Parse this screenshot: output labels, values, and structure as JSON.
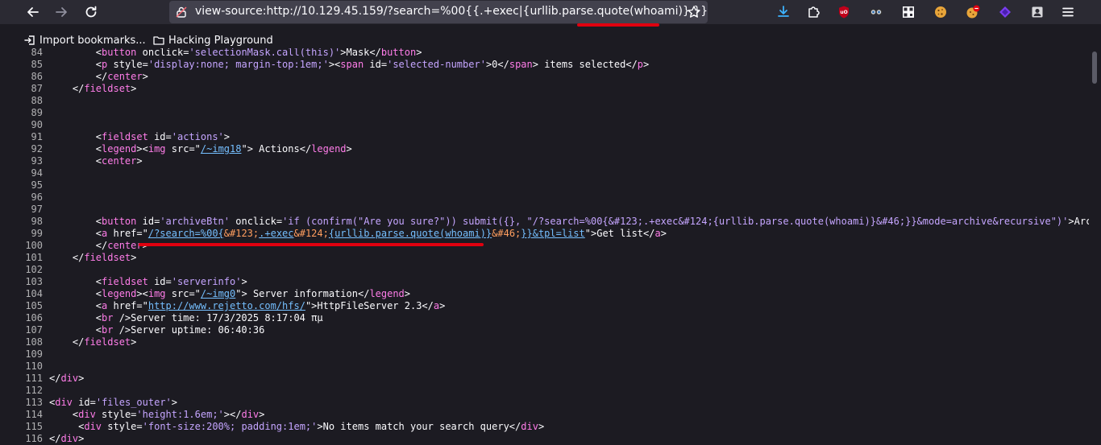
{
  "browser": {
    "url": "view-source:http://10.129.45.159/?search=%00{{.+exec|{urllib.parse.quote(whoami)}.}}",
    "bookmarks": [
      {
        "label": "Import bookmarks...",
        "icon": "import-icon"
      },
      {
        "label": "Hacking Playground",
        "icon": "folder-icon"
      }
    ],
    "colors": {
      "toolbar": "#2b2a33",
      "urlbar": "#42414d",
      "page": "#1c1b22",
      "annotation": "#e0000f"
    }
  },
  "source": {
    "lines": [
      {
        "n": "84",
        "parts": [
          [
            "t",
            "        <"
          ],
          [
            "tag",
            "button"
          ],
          [
            "t",
            " "
          ],
          [
            "an",
            "onclick"
          ],
          [
            "t",
            "="
          ],
          [
            "av",
            "'selectionMask.call(this)'"
          ],
          [
            "t",
            ">Mask</"
          ],
          [
            "tag",
            "button"
          ],
          [
            "t",
            ">"
          ]
        ]
      },
      {
        "n": "85",
        "parts": [
          [
            "t",
            "        <"
          ],
          [
            "tag",
            "p"
          ],
          [
            "t",
            " "
          ],
          [
            "an",
            "style"
          ],
          [
            "t",
            "="
          ],
          [
            "av",
            "'display:none; margin-top:1em;'"
          ],
          [
            "t",
            "><"
          ],
          [
            "tag",
            "span"
          ],
          [
            "t",
            " "
          ],
          [
            "an",
            "id"
          ],
          [
            "t",
            "="
          ],
          [
            "av",
            "'selected-number'"
          ],
          [
            "t",
            ">0</"
          ],
          [
            "tag",
            "span"
          ],
          [
            "t",
            "> items selected</"
          ],
          [
            "tag",
            "p"
          ],
          [
            "t",
            ">"
          ]
        ]
      },
      {
        "n": "86",
        "parts": [
          [
            "t",
            "        </"
          ],
          [
            "tag",
            "center"
          ],
          [
            "t",
            ">"
          ]
        ]
      },
      {
        "n": "87",
        "parts": [
          [
            "t",
            "    </"
          ],
          [
            "tag",
            "fieldset"
          ],
          [
            "t",
            ">"
          ]
        ]
      },
      {
        "n": "88",
        "parts": []
      },
      {
        "n": "89",
        "parts": []
      },
      {
        "n": "90",
        "parts": []
      },
      {
        "n": "91",
        "parts": [
          [
            "t",
            "        <"
          ],
          [
            "tag",
            "fieldset"
          ],
          [
            "t",
            " "
          ],
          [
            "an",
            "id"
          ],
          [
            "t",
            "="
          ],
          [
            "av",
            "'actions'"
          ],
          [
            "t",
            ">"
          ]
        ]
      },
      {
        "n": "92",
        "parts": [
          [
            "t",
            "        <"
          ],
          [
            "tag",
            "legend"
          ],
          [
            "t",
            "><"
          ],
          [
            "tag",
            "img"
          ],
          [
            "t",
            " "
          ],
          [
            "an",
            "src"
          ],
          [
            "t",
            "=\""
          ],
          [
            "lk",
            "/~img18"
          ],
          [
            "t",
            "\"> Actions</"
          ],
          [
            "tag",
            "legend"
          ],
          [
            "t",
            ">"
          ]
        ]
      },
      {
        "n": "93",
        "parts": [
          [
            "t",
            "        <"
          ],
          [
            "tag",
            "center"
          ],
          [
            "t",
            ">"
          ]
        ]
      },
      {
        "n": "94",
        "parts": []
      },
      {
        "n": "95",
        "parts": []
      },
      {
        "n": "96",
        "parts": []
      },
      {
        "n": "97",
        "parts": []
      },
      {
        "n": "98",
        "parts": [
          [
            "t",
            "        <"
          ],
          [
            "tag",
            "button"
          ],
          [
            "t",
            " "
          ],
          [
            "an",
            "id"
          ],
          [
            "t",
            "="
          ],
          [
            "av",
            "'archiveBtn'"
          ],
          [
            "t",
            " "
          ],
          [
            "an",
            "onclick"
          ],
          [
            "t",
            "="
          ],
          [
            "av",
            "'if (confirm(\"Are you sure?\")) submit({}, \"/?search=%00{&#123;.+exec&#124;{urllib.parse.quote(whoami)}&#46;}}&mode=archive&recursive\")'"
          ],
          [
            "t",
            ">Archive</"
          ],
          [
            "tag",
            "button"
          ],
          [
            "t",
            ">"
          ]
        ]
      },
      {
        "n": "99",
        "parts": [
          [
            "t",
            "        <"
          ],
          [
            "tag",
            "a"
          ],
          [
            "t",
            " "
          ],
          [
            "an",
            "href"
          ],
          [
            "t",
            "=\""
          ],
          [
            "lk",
            "/?search=%00{"
          ],
          [
            "ent",
            "&#123;"
          ],
          [
            "lk",
            ".+exec"
          ],
          [
            "ent",
            "&#124;"
          ],
          [
            "lk",
            "{urllib.parse.quote(whoami)}"
          ],
          [
            "ent",
            "&#46;"
          ],
          [
            "lk",
            "}}&tpl=list"
          ],
          [
            "t",
            "\">Get list</"
          ],
          [
            "tag",
            "a"
          ],
          [
            "t",
            ">"
          ]
        ]
      },
      {
        "n": "100",
        "parts": [
          [
            "t",
            "        </"
          ],
          [
            "tag",
            "center"
          ],
          [
            "t",
            ">"
          ]
        ]
      },
      {
        "n": "101",
        "parts": [
          [
            "t",
            "    </"
          ],
          [
            "tag",
            "fieldset"
          ],
          [
            "t",
            ">"
          ]
        ]
      },
      {
        "n": "102",
        "parts": []
      },
      {
        "n": "103",
        "parts": [
          [
            "t",
            "        <"
          ],
          [
            "tag",
            "fieldset"
          ],
          [
            "t",
            " "
          ],
          [
            "an",
            "id"
          ],
          [
            "t",
            "="
          ],
          [
            "av",
            "'serverinfo'"
          ],
          [
            "t",
            ">"
          ]
        ]
      },
      {
        "n": "104",
        "parts": [
          [
            "t",
            "        <"
          ],
          [
            "tag",
            "legend"
          ],
          [
            "t",
            "><"
          ],
          [
            "tag",
            "img"
          ],
          [
            "t",
            " "
          ],
          [
            "an",
            "src"
          ],
          [
            "t",
            "=\""
          ],
          [
            "lk",
            "/~img0"
          ],
          [
            "t",
            "\"> Server information</"
          ],
          [
            "tag",
            "legend"
          ],
          [
            "t",
            ">"
          ]
        ]
      },
      {
        "n": "105",
        "parts": [
          [
            "t",
            "        <"
          ],
          [
            "tag",
            "a"
          ],
          [
            "t",
            " "
          ],
          [
            "an",
            "href"
          ],
          [
            "t",
            "=\""
          ],
          [
            "lk",
            "http://www.rejetto.com/hfs/"
          ],
          [
            "t",
            "\">HttpFileServer 2.3</"
          ],
          [
            "tag",
            "a"
          ],
          [
            "t",
            ">"
          ]
        ]
      },
      {
        "n": "106",
        "parts": [
          [
            "t",
            "        <"
          ],
          [
            "tag",
            "br"
          ],
          [
            "t",
            " />Server time: 17/3/2025 8:17:04 πμ"
          ]
        ]
      },
      {
        "n": "107",
        "parts": [
          [
            "t",
            "        <"
          ],
          [
            "tag",
            "br"
          ],
          [
            "t",
            " />Server uptime: 06:40:36"
          ]
        ]
      },
      {
        "n": "108",
        "parts": [
          [
            "t",
            "    </"
          ],
          [
            "tag",
            "fieldset"
          ],
          [
            "t",
            ">"
          ]
        ]
      },
      {
        "n": "109",
        "parts": []
      },
      {
        "n": "110",
        "parts": []
      },
      {
        "n": "111",
        "parts": [
          [
            "t",
            "</"
          ],
          [
            "tag",
            "div"
          ],
          [
            "t",
            ">"
          ]
        ]
      },
      {
        "n": "112",
        "parts": []
      },
      {
        "n": "113",
        "parts": [
          [
            "t",
            "<"
          ],
          [
            "tag",
            "div"
          ],
          [
            "t",
            " "
          ],
          [
            "an",
            "id"
          ],
          [
            "t",
            "="
          ],
          [
            "av",
            "'files_outer'"
          ],
          [
            "t",
            ">"
          ]
        ]
      },
      {
        "n": "114",
        "parts": [
          [
            "t",
            "    <"
          ],
          [
            "tag",
            "div"
          ],
          [
            "t",
            " "
          ],
          [
            "an",
            "style"
          ],
          [
            "t",
            "="
          ],
          [
            "av",
            "'height:1.6em;'"
          ],
          [
            "t",
            "></"
          ],
          [
            "tag",
            "div"
          ],
          [
            "t",
            ">"
          ]
        ]
      },
      {
        "n": "115",
        "parts": [
          [
            "t",
            "     <"
          ],
          [
            "tag",
            "div"
          ],
          [
            "t",
            " "
          ],
          [
            "an",
            "style"
          ],
          [
            "t",
            "="
          ],
          [
            "av",
            "'font-size:200%; padding:1em;'"
          ],
          [
            "t",
            ">No items match your search query</"
          ],
          [
            "tag",
            "div"
          ],
          [
            "t",
            ">"
          ]
        ]
      },
      {
        "n": "116",
        "parts": [
          [
            "t",
            "</"
          ],
          [
            "tag",
            "div"
          ],
          [
            "t",
            ">"
          ]
        ]
      }
    ]
  }
}
